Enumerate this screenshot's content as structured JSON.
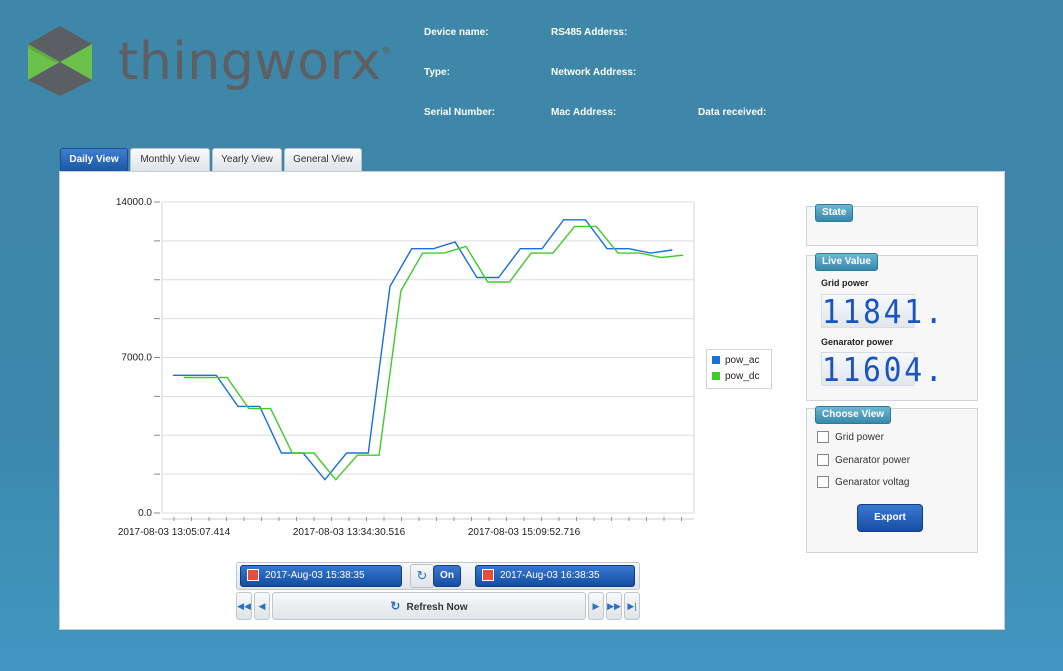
{
  "brand": {
    "logo_text": "thingworx",
    "registered": "®"
  },
  "device_info": {
    "device_name_label": "Device name:",
    "rs485_label": "RS485 Adderss:",
    "type_label": "Type:",
    "network_label": "Network Address:",
    "serial_label": "Serial Number:",
    "mac_label": "Mac Address:",
    "data_received_label": "Data received:"
  },
  "tabs": [
    {
      "label": "Daily View",
      "active": true
    },
    {
      "label": "Monthly View",
      "active": false
    },
    {
      "label": "Yearly View",
      "active": false
    },
    {
      "label": "General View",
      "active": false
    }
  ],
  "chart_data": {
    "type": "line",
    "ylim": [
      0,
      14000
    ],
    "y_tick_labels": [
      "14000.0",
      "7000.0",
      "0.0"
    ],
    "y_tick_values": [
      14000,
      7000,
      0
    ],
    "x_tick_labels": [
      "2017-08-03 13:05:07.414",
      "2017-08-03 13:34:30.516",
      "2017-08-03 15:09:52.716"
    ],
    "grid": true,
    "legend_position": "right",
    "series": [
      {
        "name": "pow_ac",
        "color": "#1a6fd8",
        "points": [
          [
            0,
            6200
          ],
          [
            2,
            6200
          ],
          [
            3,
            4800
          ],
          [
            4,
            4800
          ],
          [
            5,
            2700
          ],
          [
            6,
            2700
          ],
          [
            7,
            1500
          ],
          [
            8,
            2700
          ],
          [
            9,
            2700
          ],
          [
            10,
            10200
          ],
          [
            11,
            11900
          ],
          [
            12,
            11900
          ],
          [
            13,
            12200
          ],
          [
            14,
            10600
          ],
          [
            15,
            10600
          ],
          [
            16,
            11900
          ],
          [
            17,
            11900
          ],
          [
            18,
            13200
          ],
          [
            19,
            13200
          ],
          [
            20,
            11900
          ],
          [
            21,
            11900
          ],
          [
            22,
            11700
          ],
          [
            23,
            11840
          ]
        ]
      },
      {
        "name": "pow_dc",
        "color": "#3ccd2a",
        "points": [
          [
            0.5,
            6100
          ],
          [
            2.5,
            6100
          ],
          [
            3.5,
            4700
          ],
          [
            4.5,
            4700
          ],
          [
            5.5,
            2700
          ],
          [
            6.5,
            2700
          ],
          [
            7.5,
            1500
          ],
          [
            8.5,
            2600
          ],
          [
            9.5,
            2600
          ],
          [
            10.5,
            10000
          ],
          [
            11.5,
            11700
          ],
          [
            12.5,
            11700
          ],
          [
            13.5,
            12000
          ],
          [
            14.5,
            10400
          ],
          [
            15.5,
            10400
          ],
          [
            16.5,
            11700
          ],
          [
            17.5,
            11700
          ],
          [
            18.5,
            12900
          ],
          [
            19.5,
            12900
          ],
          [
            20.5,
            11700
          ],
          [
            21.5,
            11700
          ],
          [
            22.5,
            11500
          ],
          [
            23.5,
            11604
          ]
        ]
      }
    ]
  },
  "state_box": {
    "title": "State"
  },
  "live_value": {
    "title": "Live Value",
    "grid_label": "Grid power",
    "grid_value": "11841.",
    "generator_label": "Genarator power",
    "generator_value": "11604."
  },
  "choose_view": {
    "title": "Choose View",
    "options": [
      {
        "label": "Grid power",
        "checked": false
      },
      {
        "label": "Genarator power",
        "checked": false
      },
      {
        "label": "Genarator voltag",
        "checked": false
      }
    ],
    "export_label": "Export"
  },
  "controls": {
    "start_datetime": "2017-Aug-03 15:38:35",
    "toggle_label": "On",
    "end_datetime": "2017-Aug-03 16:38:35",
    "refresh_label": "Refresh Now"
  },
  "colors": {
    "accent": "#1d5bb0",
    "background": "#3b86aa"
  }
}
